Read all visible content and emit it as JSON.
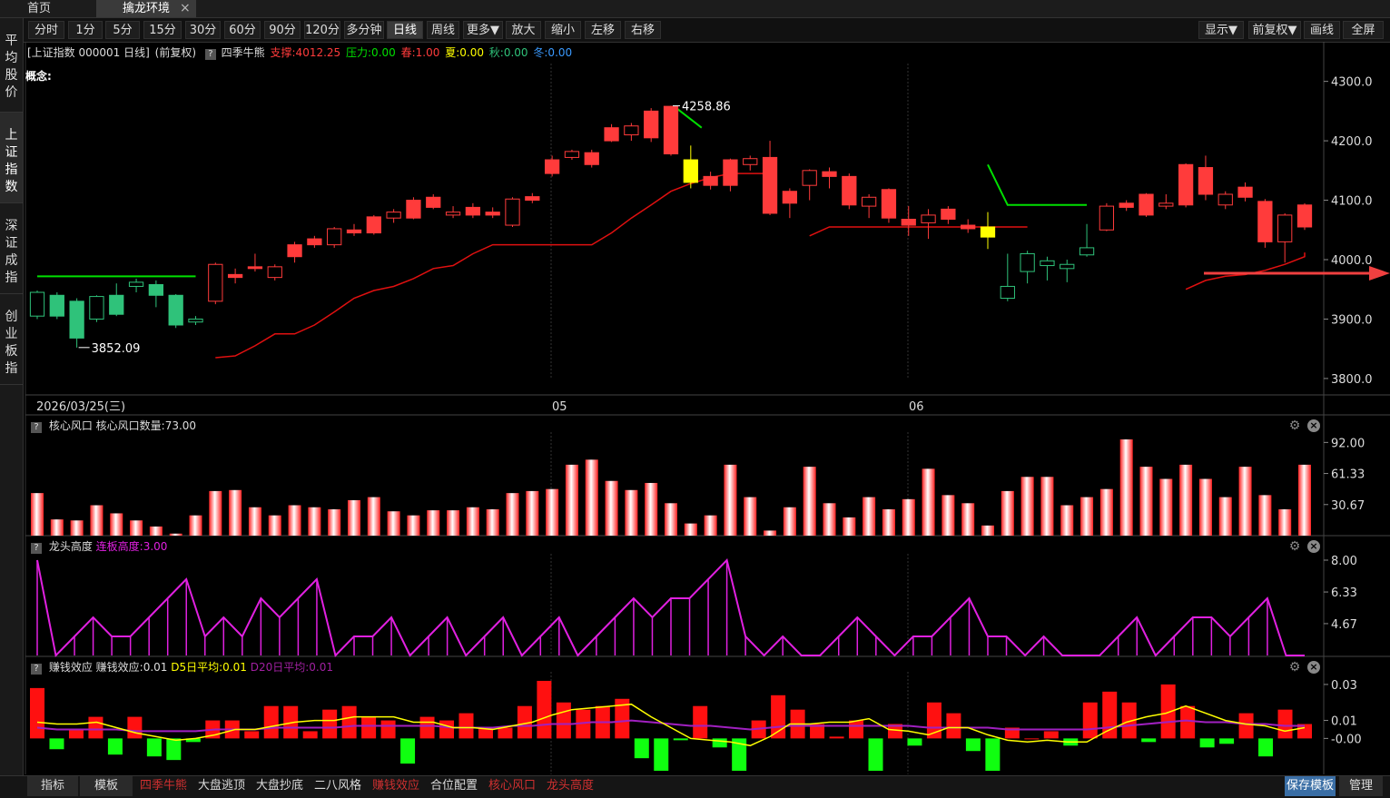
{
  "top_tabs": {
    "home": "首页",
    "active": "擒龙环境",
    "close": "×"
  },
  "sidebar": [
    {
      "label": "平均股价",
      "active": false
    },
    {
      "label": "上证指数",
      "active": true
    },
    {
      "label": "深证成指",
      "active": false
    },
    {
      "label": "创业板指",
      "active": false
    }
  ],
  "toolbar": {
    "left": [
      "分时",
      "1分",
      "5分",
      "15分",
      "30分",
      "60分",
      "90分",
      "120分",
      "多分钟",
      "日线",
      "周线",
      "更多▼",
      "放大",
      "缩小",
      "左移",
      "右移"
    ],
    "active": "日线",
    "right": [
      "显示▼",
      "前复权▼",
      "画线",
      "全屏"
    ]
  },
  "info": {
    "title": "[上证指数 000001 日线]",
    "adjust": "(前复权)",
    "qmark": "?",
    "indicator": "四季牛熊",
    "support": "支撑:4012.25",
    "pressure": "压力:0.00",
    "spring": "春:1.00",
    "summer": "夏:0.00",
    "autumn": "秋:0.00",
    "winter": "冬:0.00",
    "concept": "概念:"
  },
  "colors": {
    "up": "#ff3b3b",
    "down_green": "#2fc27a",
    "yellow": "#ffff00",
    "magenta": "#e020e0",
    "line_green": "#00e000",
    "axis_text": "#dddddd"
  },
  "chart_data": [
    {
      "type": "candlestick",
      "ylim": [
        3780,
        4330
      ],
      "yticks": [
        "4300.0",
        "4200.0",
        "4100.0",
        "4000.0",
        "3900.0",
        "3800.0"
      ],
      "x_labels": [
        "2026/03/25(三)",
        "05",
        "06"
      ],
      "high_marker": "4258.86",
      "low_marker": "3852.09",
      "candles": [
        {
          "o": 3905,
          "c": 3945,
          "h": 3948,
          "l": 3900,
          "k": "g"
        },
        {
          "o": 3940,
          "c": 3905,
          "h": 3945,
          "l": 3900,
          "k": "g"
        },
        {
          "o": 3930,
          "c": 3868,
          "h": 3935,
          "l": 3852,
          "k": "g"
        },
        {
          "o": 3900,
          "c": 3938,
          "h": 3940,
          "l": 3895,
          "k": "g"
        },
        {
          "o": 3940,
          "c": 3908,
          "h": 3960,
          "l": 3905,
          "k": "g"
        },
        {
          "o": 3955,
          "c": 3962,
          "h": 3968,
          "l": 3945,
          "k": "g"
        },
        {
          "o": 3958,
          "c": 3940,
          "h": 3965,
          "l": 3920,
          "k": "g"
        },
        {
          "o": 3940,
          "c": 3890,
          "h": 3942,
          "l": 3885,
          "k": "g"
        },
        {
          "o": 3895,
          "c": 3900,
          "h": 3905,
          "l": 3890,
          "k": "g"
        },
        {
          "o": 3930,
          "c": 3992,
          "h": 3995,
          "l": 3925,
          "k": "r"
        },
        {
          "o": 3970,
          "c": 3975,
          "h": 3985,
          "l": 3960,
          "k": "r"
        },
        {
          "o": 3985,
          "c": 3988,
          "h": 4010,
          "l": 3980,
          "k": "r"
        },
        {
          "o": 3970,
          "c": 3988,
          "h": 3992,
          "l": 3965,
          "k": "r"
        },
        {
          "o": 4005,
          "c": 4025,
          "h": 4030,
          "l": 3995,
          "k": "r"
        },
        {
          "o": 4025,
          "c": 4035,
          "h": 4040,
          "l": 4020,
          "k": "r"
        },
        {
          "o": 4025,
          "c": 4052,
          "h": 4055,
          "l": 4020,
          "k": "r"
        },
        {
          "o": 4045,
          "c": 4050,
          "h": 4060,
          "l": 4040,
          "k": "r"
        },
        {
          "o": 4045,
          "c": 4072,
          "h": 4075,
          "l": 4042,
          "k": "r"
        },
        {
          "o": 4070,
          "c": 4080,
          "h": 4085,
          "l": 4062,
          "k": "r"
        },
        {
          "o": 4070,
          "c": 4100,
          "h": 4105,
          "l": 4068,
          "k": "r"
        },
        {
          "o": 4088,
          "c": 4105,
          "h": 4110,
          "l": 4085,
          "k": "r"
        },
        {
          "o": 4075,
          "c": 4080,
          "h": 4090,
          "l": 4070,
          "k": "r"
        },
        {
          "o": 4075,
          "c": 4088,
          "h": 4095,
          "l": 4070,
          "k": "r"
        },
        {
          "o": 4075,
          "c": 4080,
          "h": 4088,
          "l": 4070,
          "k": "r"
        },
        {
          "o": 4058,
          "c": 4102,
          "h": 4105,
          "l": 4055,
          "k": "r"
        },
        {
          "o": 4100,
          "c": 4106,
          "h": 4112,
          "l": 4095,
          "k": "r"
        },
        {
          "o": 4145,
          "c": 4168,
          "h": 4175,
          "l": 4140,
          "k": "r"
        },
        {
          "o": 4172,
          "c": 4182,
          "h": 4185,
          "l": 4168,
          "k": "r"
        },
        {
          "o": 4160,
          "c": 4180,
          "h": 4185,
          "l": 4155,
          "k": "r"
        },
        {
          "o": 4200,
          "c": 4222,
          "h": 4228,
          "l": 4198,
          "k": "r"
        },
        {
          "o": 4210,
          "c": 4225,
          "h": 4230,
          "l": 4200,
          "k": "r"
        },
        {
          "o": 4205,
          "c": 4250,
          "h": 4255,
          "l": 4198,
          "k": "r"
        },
        {
          "o": 4178,
          "c": 4258,
          "h": 4259,
          "l": 4175,
          "k": "r"
        },
        {
          "o": 4168,
          "c": 4130,
          "h": 4192,
          "l": 4120,
          "k": "y"
        },
        {
          "o": 4125,
          "c": 4140,
          "h": 4148,
          "l": 4118,
          "k": "r"
        },
        {
          "o": 4125,
          "c": 4168,
          "h": 4170,
          "l": 4115,
          "k": "r"
        },
        {
          "o": 4160,
          "c": 4170,
          "h": 4175,
          "l": 4150,
          "k": "r"
        },
        {
          "o": 4078,
          "c": 4172,
          "h": 4200,
          "l": 4075,
          "k": "r"
        },
        {
          "o": 4095,
          "c": 4115,
          "h": 4120,
          "l": 4070,
          "k": "r"
        },
        {
          "o": 4125,
          "c": 4150,
          "h": 4152,
          "l": 4100,
          "k": "r"
        },
        {
          "o": 4140,
          "c": 4148,
          "h": 4155,
          "l": 4120,
          "k": "r"
        },
        {
          "o": 4092,
          "c": 4140,
          "h": 4145,
          "l": 4085,
          "k": "r"
        },
        {
          "o": 4090,
          "c": 4105,
          "h": 4110,
          "l": 4070,
          "k": "r"
        },
        {
          "o": 4070,
          "c": 4118,
          "h": 4120,
          "l": 4062,
          "k": "r"
        },
        {
          "o": 4058,
          "c": 4068,
          "h": 4090,
          "l": 4040,
          "k": "r"
        },
        {
          "o": 4062,
          "c": 4075,
          "h": 4085,
          "l": 4035,
          "k": "r"
        },
        {
          "o": 4068,
          "c": 4085,
          "h": 4090,
          "l": 4060,
          "k": "r"
        },
        {
          "o": 4052,
          "c": 4058,
          "h": 4068,
          "l": 4045,
          "k": "r"
        },
        {
          "o": 4038,
          "c": 4055,
          "h": 4080,
          "l": 4018,
          "k": "y"
        },
        {
          "o": 3955,
          "c": 3935,
          "h": 4010,
          "l": 3930,
          "k": "gh"
        },
        {
          "o": 3980,
          "c": 4010,
          "h": 4015,
          "l": 3960,
          "k": "gh"
        },
        {
          "o": 3990,
          "c": 3998,
          "h": 4005,
          "l": 3965,
          "k": "gh"
        },
        {
          "o": 3985,
          "c": 3992,
          "h": 4000,
          "l": 3962,
          "k": "gh"
        },
        {
          "o": 4020,
          "c": 4008,
          "h": 4060,
          "l": 4005,
          "k": "gh"
        },
        {
          "o": 4050,
          "c": 4090,
          "h": 4095,
          "l": 4048,
          "k": "r"
        },
        {
          "o": 4088,
          "c": 4095,
          "h": 4100,
          "l": 4082,
          "k": "r"
        },
        {
          "o": 4075,
          "c": 4110,
          "h": 4112,
          "l": 4072,
          "k": "r"
        },
        {
          "o": 4090,
          "c": 4095,
          "h": 4110,
          "l": 4085,
          "k": "r"
        },
        {
          "o": 4092,
          "c": 4160,
          "h": 4162,
          "l": 4088,
          "k": "r"
        },
        {
          "o": 4110,
          "c": 4155,
          "h": 4175,
          "l": 4100,
          "k": "r"
        },
        {
          "o": 4092,
          "c": 4110,
          "h": 4115,
          "l": 4085,
          "k": "r"
        },
        {
          "o": 4105,
          "c": 4122,
          "h": 4130,
          "l": 4098,
          "k": "r"
        },
        {
          "o": 4030,
          "c": 4098,
          "h": 4102,
          "l": 4020,
          "k": "r"
        },
        {
          "o": 4030,
          "c": 4075,
          "h": 4078,
          "l": 3995,
          "k": "r"
        },
        {
          "o": 4055,
          "c": 4092,
          "h": 4095,
          "l": 4050,
          "k": "r"
        }
      ],
      "support_line": [
        null,
        null,
        null,
        null,
        null,
        null,
        null,
        null,
        null,
        3835,
        3838,
        3855,
        3875,
        3875,
        3890,
        3912,
        3935,
        3948,
        3955,
        3968,
        3985,
        3990,
        4010,
        4025,
        4025,
        4025,
        4025,
        4025,
        4025,
        4045,
        4070,
        4092,
        4115,
        4128,
        4138,
        4145,
        4145,
        4145,
        null,
        4040,
        4055,
        4055,
        4055,
        4055,
        4055,
        4055,
        4055,
        4055,
        4055,
        4055,
        4055,
        null,
        null,
        null,
        null,
        null,
        null,
        null,
        3950,
        3965,
        3972,
        3975,
        3982,
        3992,
        4005,
        4012,
        4012,
        4012,
        4012,
        4012,
        4012,
        4012,
        4012,
        4012
      ],
      "green_line_left": 3972,
      "green_line_right": 4092
    },
    {
      "type": "bar",
      "title": "核心风口",
      "series_label": "核心风口数量:73.00",
      "yticks": [
        "92.00",
        "61.33",
        "30.67"
      ],
      "ylim": [
        0,
        95
      ],
      "values": [
        42,
        16,
        15,
        30,
        22,
        15,
        9,
        2,
        20,
        44,
        45,
        28,
        20,
        30,
        28,
        26,
        35,
        38,
        24,
        20,
        25,
        25,
        28,
        26,
        42,
        44,
        46,
        70,
        75,
        54,
        45,
        52,
        32,
        12,
        20,
        70,
        38,
        5,
        28,
        68,
        32,
        18,
        38,
        26,
        36,
        66,
        40,
        32,
        10,
        44,
        58,
        58,
        30,
        38,
        46,
        95,
        68,
        56,
        70,
        56,
        38,
        68,
        40,
        26,
        70
      ]
    },
    {
      "type": "line",
      "title": "龙头高度",
      "series_label": "连板高度:3.00",
      "yticks": [
        "8.00",
        "6.33",
        "4.67"
      ],
      "ylim": [
        3,
        8
      ],
      "values": [
        8,
        3,
        4,
        5,
        4,
        4,
        5,
        6,
        7,
        4,
        5,
        4,
        6,
        5,
        6,
        7,
        3,
        4,
        4,
        5,
        3,
        4,
        5,
        3,
        4,
        5,
        3,
        4,
        5,
        3,
        4,
        5,
        6,
        5,
        6,
        6,
        7,
        8,
        4,
        3,
        4,
        3,
        3,
        4,
        5,
        4,
        3,
        4,
        4,
        5,
        6,
        4,
        4,
        3,
        4,
        3,
        3,
        3,
        4,
        5,
        3,
        4,
        5,
        5,
        4,
        5,
        6,
        3,
        3
      ]
    },
    {
      "type": "bar",
      "title": "赚钱效应",
      "series_label": "赚钱效应:0.01",
      "d5_label": "D5日平均:0.01",
      "d20_label": "D20日平均:0.01",
      "yticks": [
        "0.03",
        "0.01",
        "-0.00"
      ],
      "ylim": [
        -0.02,
        0.034
      ],
      "values": [
        0.028,
        -0.006,
        0.005,
        0.012,
        -0.009,
        0.012,
        -0.01,
        -0.012,
        -0.002,
        0.01,
        0.01,
        0.004,
        0.018,
        0.018,
        0.004,
        0.016,
        0.018,
        0.012,
        0.01,
        -0.014,
        0.012,
        0.01,
        0.014,
        0.006,
        0.006,
        0.018,
        0.032,
        0.02,
        0.016,
        0.018,
        0.022,
        -0.011,
        -0.018,
        -0.001,
        0.018,
        -0.005,
        -0.018,
        0.01,
        0.024,
        0.016,
        0.008,
        0.001,
        0.01,
        -0.018,
        0.008,
        -0.004,
        0.02,
        0.014,
        -0.007,
        -0.018,
        0.006,
        0.0,
        0.004,
        -0.004,
        0.02,
        0.026,
        0.02,
        -0.002,
        0.03,
        0.018,
        -0.005,
        -0.003,
        0.014,
        -0.01,
        0.016,
        0.008
      ],
      "d5": [
        0.009,
        0.008,
        0.008,
        0.009,
        0.006,
        0.003,
        0.001,
        -0.001,
        0.0,
        0.002,
        0.005,
        0.005,
        0.007,
        0.009,
        0.01,
        0.01,
        0.012,
        0.012,
        0.012,
        0.009,
        0.009,
        0.006,
        0.006,
        0.005,
        0.007,
        0.009,
        0.013,
        0.016,
        0.017,
        0.018,
        0.019,
        0.012,
        0.006,
        0.0,
        -0.001,
        -0.002,
        -0.004,
        0.001,
        0.008,
        0.008,
        0.009,
        0.009,
        0.011,
        0.005,
        0.004,
        0.002,
        0.006,
        0.006,
        0.002,
        -0.001,
        -0.002,
        -0.001,
        -0.002,
        -0.002,
        0.004,
        0.009,
        0.012,
        0.014,
        0.018,
        0.014,
        0.01,
        0.008,
        0.007,
        0.004,
        0.006
      ],
      "d20": [
        0.006,
        0.005,
        0.005,
        0.005,
        0.005,
        0.004,
        0.004,
        0.004,
        0.004,
        0.005,
        0.005,
        0.005,
        0.006,
        0.006,
        0.006,
        0.006,
        0.007,
        0.007,
        0.007,
        0.007,
        0.007,
        0.006,
        0.006,
        0.006,
        0.007,
        0.007,
        0.008,
        0.008,
        0.009,
        0.009,
        0.01,
        0.009,
        0.008,
        0.007,
        0.007,
        0.006,
        0.005,
        0.006,
        0.007,
        0.007,
        0.007,
        0.007,
        0.007,
        0.007,
        0.007,
        0.006,
        0.006,
        0.006,
        0.006,
        0.005,
        0.005,
        0.005,
        0.005,
        0.005,
        0.006,
        0.007,
        0.008,
        0.009,
        0.01,
        0.009,
        0.009,
        0.008,
        0.008,
        0.007,
        0.007
      ]
    }
  ],
  "bottom_tabs": {
    "left": [
      "指标",
      "模板"
    ],
    "indicators": [
      "四季牛熊",
      "大盘逃顶",
      "大盘抄底",
      "二八风格",
      "赚钱效应",
      "合位配置",
      "核心风口",
      "龙头高度"
    ],
    "right": [
      "保存模板",
      "管理"
    ]
  }
}
